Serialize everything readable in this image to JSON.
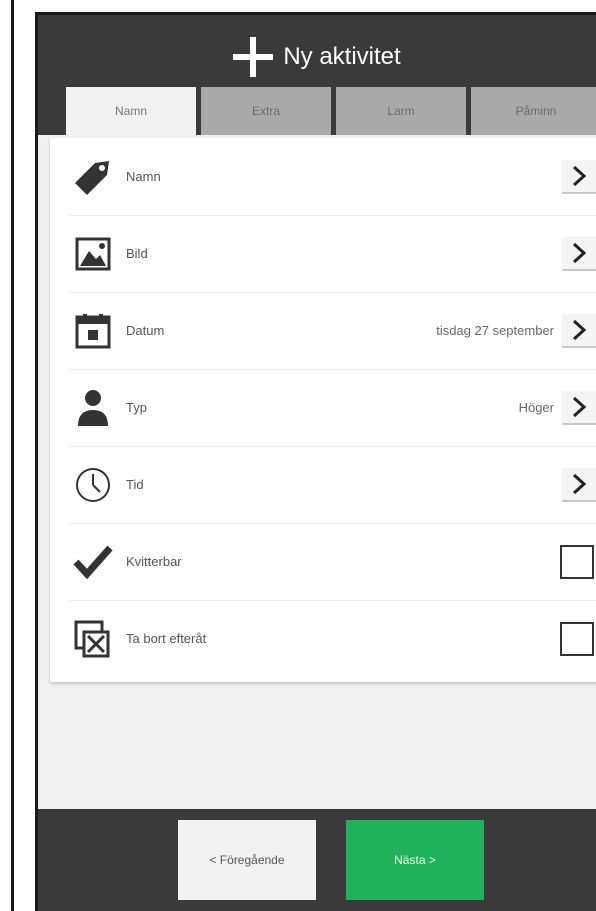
{
  "header": {
    "title": "Ny aktivitet"
  },
  "tabs": [
    {
      "label": "Namn",
      "active": true
    },
    {
      "label": "Extra",
      "active": false
    },
    {
      "label": "Larm",
      "active": false
    },
    {
      "label": "Påminn",
      "active": false
    }
  ],
  "rows": [
    {
      "label": "Namn",
      "icon": "tag-icon"
    },
    {
      "label": "Bild",
      "icon": "image-icon"
    },
    {
      "label": "Datum",
      "value": "tisdag 27 september",
      "icon": "calendar-icon"
    },
    {
      "label": "Typ",
      "value": "Höger",
      "icon": "person-icon"
    },
    {
      "label": "Tid",
      "icon": "clock-icon"
    },
    {
      "label": "Kvitterbar",
      "icon": "checkmark-icon",
      "checked": false
    },
    {
      "label": "Ta bort efteråt",
      "icon": "delete-after-icon",
      "checked": false
    }
  ],
  "footer": {
    "prev_label": "< Föregående",
    "next_label": "Nästa >"
  },
  "colors": {
    "header": "#3a3a3a",
    "next_button": "#1fb25a",
    "tab_inactive": "#a9a9a9"
  }
}
